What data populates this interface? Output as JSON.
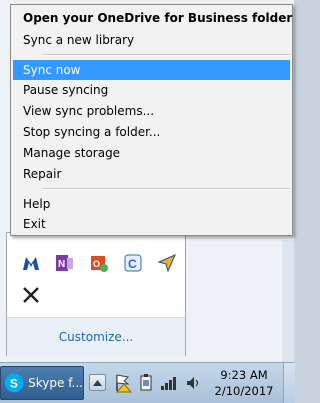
{
  "context_menu": {
    "items": [
      {
        "label": "Open your OneDrive for Business folder",
        "bold": true
      },
      {
        "label": "Sync a new library"
      },
      {
        "label": "Sync now",
        "selected": true
      },
      {
        "label": "Pause syncing"
      },
      {
        "label": "View sync problems..."
      },
      {
        "label": "Stop syncing a folder..."
      },
      {
        "label": "Manage storage"
      },
      {
        "label": "Repair"
      },
      {
        "label": "Help"
      },
      {
        "label": "Exit"
      }
    ],
    "selected_color": "#3399ff"
  },
  "tray_overflow": {
    "icons": [
      "malwarebytes-icon",
      "onenote-icon",
      "office-upload-icon",
      "cisco-icon",
      "send-arrow-icon",
      "x-app-icon"
    ],
    "customize_label": "Customize..."
  },
  "taskbar": {
    "skype_button_label": "Skype f...",
    "clock_time": "9:23 AM",
    "clock_date": "2/10/2017",
    "system_icons": [
      "action-center-flag-icon",
      "power-icon",
      "network-signal-icon",
      "volume-icon"
    ]
  }
}
